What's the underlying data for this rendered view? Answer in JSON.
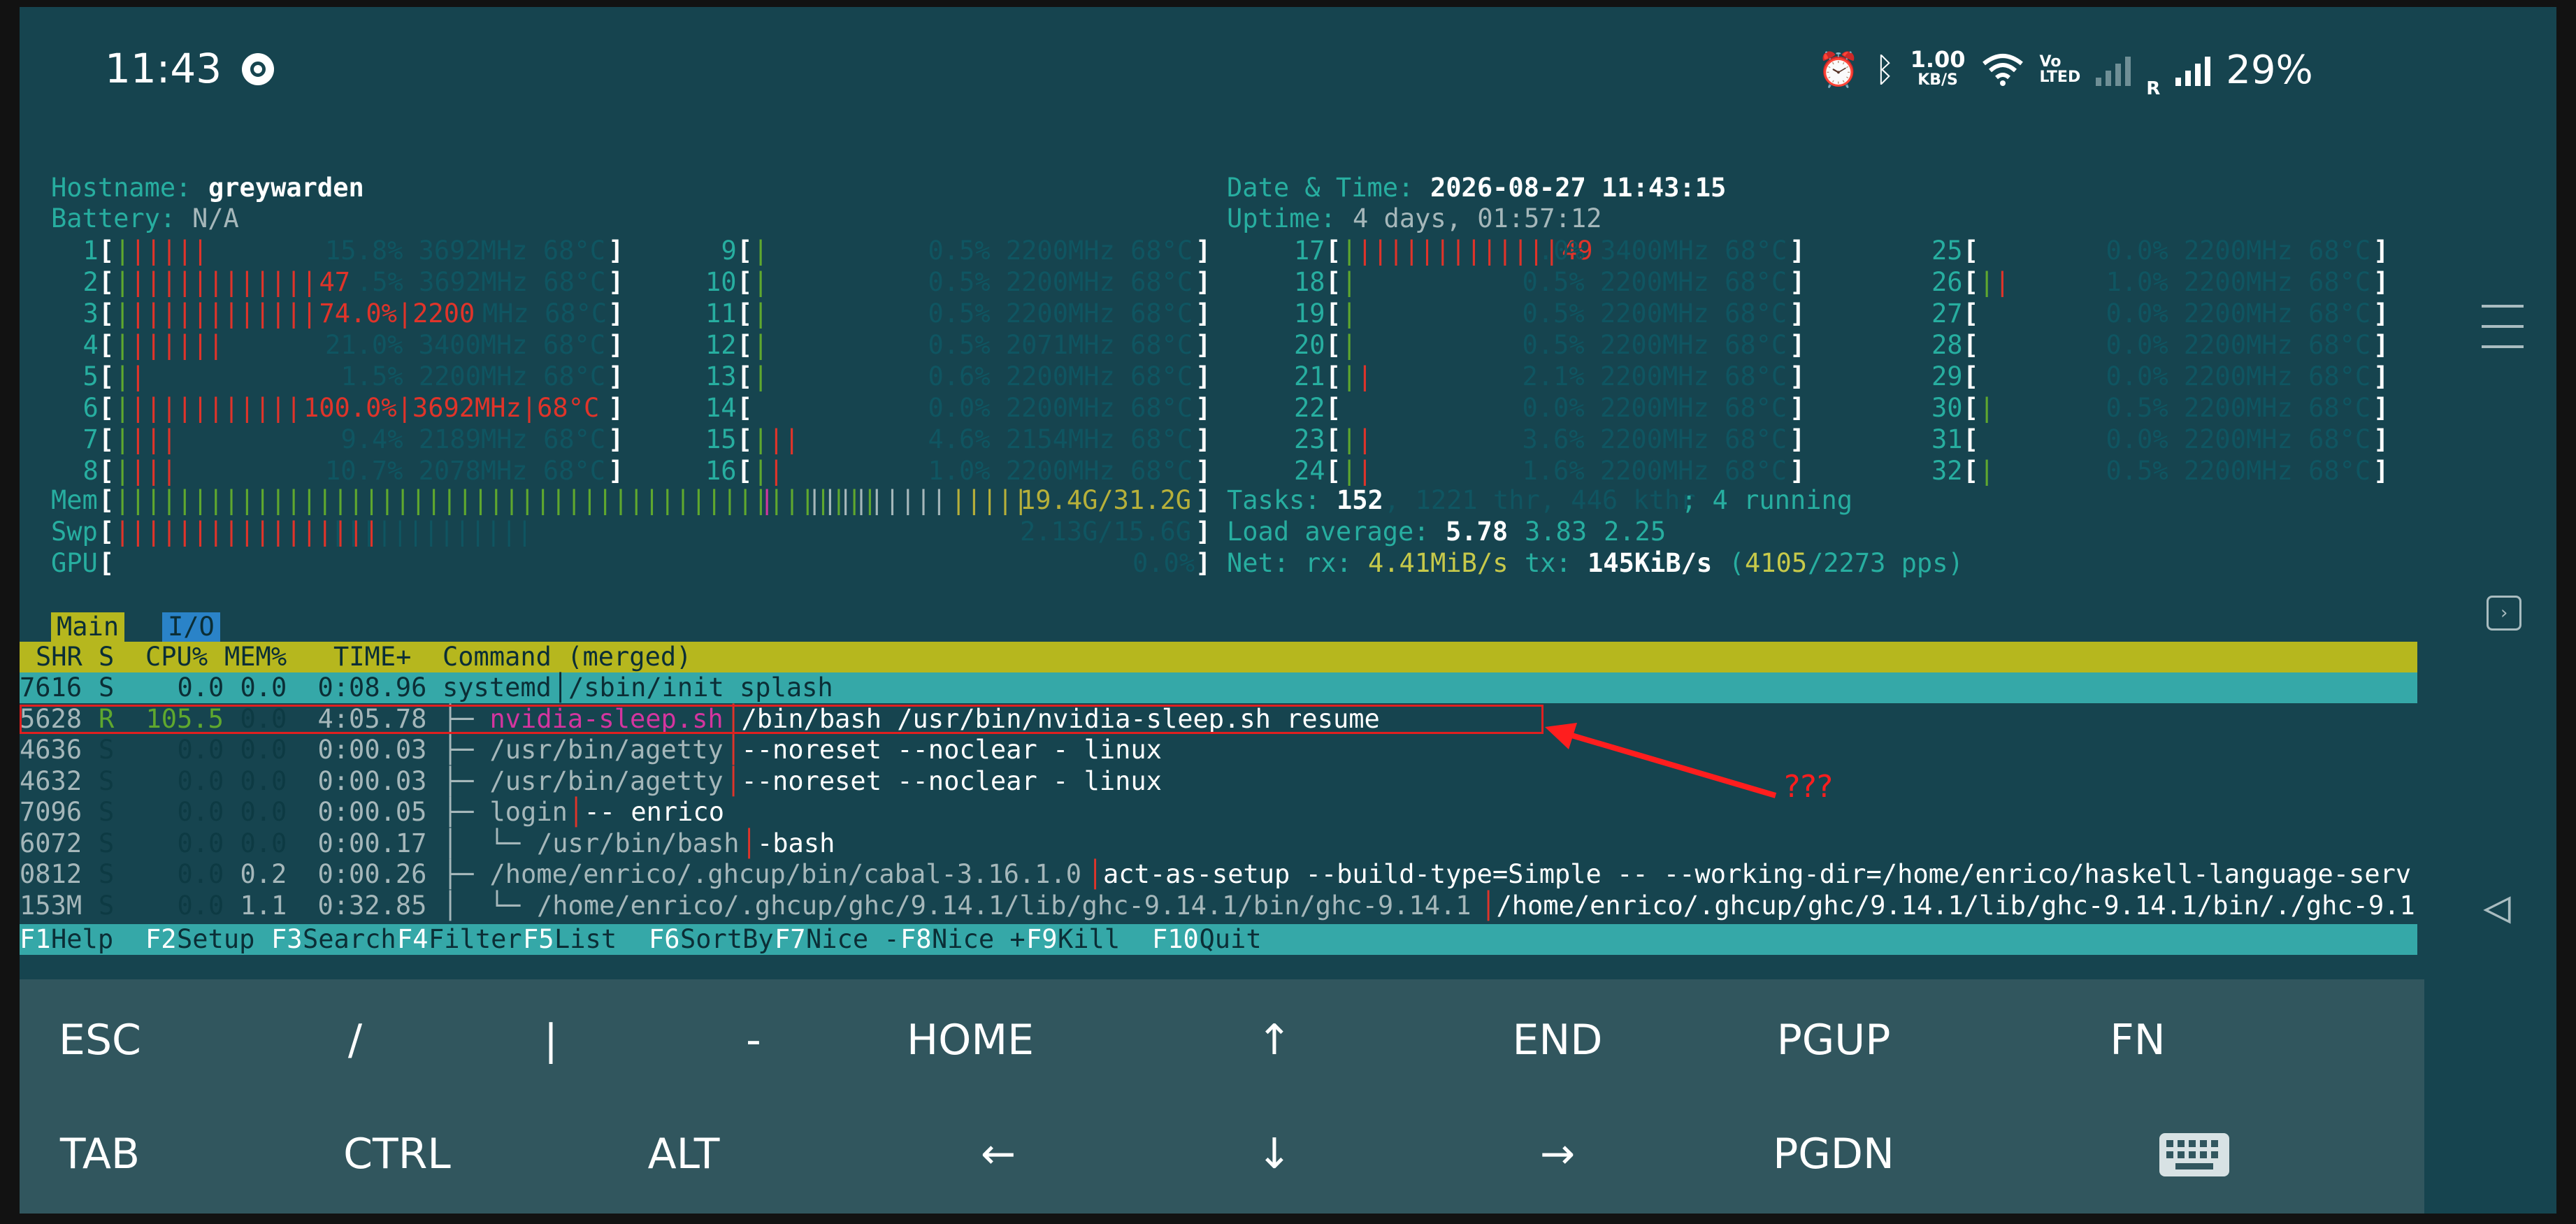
{
  "status_bar": {
    "time": "11:43",
    "net_rate_value": "1.00",
    "net_rate_unit": "KB/S",
    "volte_top": "Vo",
    "volte_bottom": "LTED",
    "roaming": "R",
    "battery": "29%",
    "icons": [
      "alarm-icon",
      "bluetooth-icon",
      "wifi-icon",
      "signal-icon"
    ]
  },
  "htop": {
    "hostname_label": "Hostname:",
    "hostname": "greywarden",
    "battery_label": "Battery:",
    "battery": "N/A",
    "datetime_label": "Date & Time:",
    "datetime": "2026-08-27 11:43:15",
    "uptime_label": "Uptime:",
    "uptime": "4 days, 01:57:12",
    "cpus": [
      {
        "id": "1",
        "bars": "||||||",
        "pre": "",
        "text": "15.8% 3692MHz 68°C"
      },
      {
        "id": "2",
        "bars": "|||||||||||||",
        "pre": "47",
        "text": ".5% 3692MHz 68°C"
      },
      {
        "id": "3",
        "bars": "|||||||||||||",
        "pre": "74.0%|2200",
        "text": "MHz 68°C"
      },
      {
        "id": "4",
        "bars": "|||||||",
        "pre": "",
        "text": "21.0% 3400MHz 68°C"
      },
      {
        "id": "5",
        "bars": "||",
        "pre": "",
        "text": "1.5% 2200MHz 68°C"
      },
      {
        "id": "6",
        "bars": "||||||||||||",
        "pre": "100.0%|3692MHz|68°C",
        "text": ""
      },
      {
        "id": "7",
        "bars": "||||",
        "pre": "",
        "text": "9.4% 2189MHz 68°C"
      },
      {
        "id": "8",
        "bars": "||||",
        "pre": "",
        "text": "10.7% 2078MHz 68°C"
      },
      {
        "id": "9",
        "bars": "|",
        "pre": "",
        "text": "0.5% 2200MHz 68°C"
      },
      {
        "id": "10",
        "bars": "|",
        "pre": "",
        "text": "0.5% 2200MHz 68°C"
      },
      {
        "id": "11",
        "bars": "|",
        "pre": "",
        "text": "0.5% 2200MHz 68°C"
      },
      {
        "id": "12",
        "bars": "|",
        "pre": "",
        "text": "0.5% 2071MHz 68°C"
      },
      {
        "id": "13",
        "bars": "|",
        "pre": "",
        "text": "0.6% 2200MHz 68°C"
      },
      {
        "id": "14",
        "bars": "",
        "pre": "",
        "text": "0.0% 2200MHz 68°C"
      },
      {
        "id": "15",
        "bars": "|||",
        "pre": "",
        "text": "4.6% 2154MHz 68°C"
      },
      {
        "id": "16",
        "bars": "||",
        "pre": "",
        "text": "1.0% 2200MHz 68°C"
      },
      {
        "id": "17",
        "bars": "||||||||||||||",
        "pre": "49",
        "text": ".0% 3400MHz 68°C"
      },
      {
        "id": "18",
        "bars": "|",
        "pre": "",
        "text": "0.5% 2200MHz 68°C"
      },
      {
        "id": "19",
        "bars": "|",
        "pre": "",
        "text": "0.5% 2200MHz 68°C"
      },
      {
        "id": "20",
        "bars": "|",
        "pre": "",
        "text": "0.5% 2200MHz 68°C"
      },
      {
        "id": "21",
        "bars": "||",
        "pre": "",
        "text": "2.1% 2200MHz 68°C"
      },
      {
        "id": "22",
        "bars": "",
        "pre": "",
        "text": "0.0% 2200MHz 68°C"
      },
      {
        "id": "23",
        "bars": "||",
        "pre": "",
        "text": "3.6% 2200MHz 68°C"
      },
      {
        "id": "24",
        "bars": "||",
        "pre": "",
        "text": "1.6% 2200MHz 68°C"
      },
      {
        "id": "25",
        "bars": "",
        "pre": "",
        "text": "0.0% 2200MHz 68°C"
      },
      {
        "id": "26",
        "bars": "||",
        "pre": "",
        "text": "1.0% 2200MHz 68°C"
      },
      {
        "id": "27",
        "bars": "",
        "pre": "",
        "text": "0.0% 2200MHz 68°C"
      },
      {
        "id": "28",
        "bars": "",
        "pre": "",
        "text": "0.0% 2200MHz 68°C"
      },
      {
        "id": "29",
        "bars": "",
        "pre": "",
        "text": "0.0% 2200MHz 68°C"
      },
      {
        "id": "30",
        "bars": "|",
        "pre": "",
        "text": "0.5% 2200MHz 68°C"
      },
      {
        "id": "31",
        "bars": "",
        "pre": "",
        "text": "0.0% 2200MHz 68°C"
      },
      {
        "id": "32",
        "bars": "|",
        "pre": "",
        "text": "0.5% 2200MHz 68°C"
      }
    ],
    "mem_label": "Mem",
    "mem_bars": "|||||||||||||||||||||||||||||||||||||||||||||||||",
    "mem_gray_bars": "|||||||||",
    "mem_tail_bars": "|||||",
    "mem_value": "19.4G/31.2G",
    "swp_label": "Swp",
    "swp_bars": "|||||||||||||||||",
    "swp_dim_bars": "|||||||||||||",
    "swp_value": "2.13G/15.6G",
    "gpu_label": "GPU",
    "gpu_value": "0.0%",
    "tasks_label": "Tasks:",
    "tasks_count": "152",
    "tasks_thr": ", 1221 thr, 446 kthr",
    "tasks_running": "; 4 running",
    "load_label": "Load average:",
    "load_1": "5.78",
    "load_5": "3.83",
    "load_15": "2.25",
    "net_label": "Net:",
    "net_rx_label": "rx:",
    "net_rx": "4.41MiB/s",
    "net_tx_label": "tx:",
    "net_tx": "145KiB/s",
    "net_pps_open": "(",
    "net_pps_rx": "4105",
    "net_pps_rest": "/2273 pps)",
    "tabs": [
      "Main",
      "I/O"
    ],
    "columns": {
      "shr": "SHR",
      "s": "S",
      "cpu": "CPU%",
      "mem": "MEM%",
      "time": "TIME+",
      "cmd": "Command (merged)"
    },
    "processes": [
      {
        "shr": "7616",
        "s": "S",
        "cpu": "0.0",
        "mem": "0.0",
        "time": "0:08.96",
        "tree": "",
        "name": "systemd",
        "args": "/sbin/init splash"
      },
      {
        "shr": "5628",
        "s": "R",
        "cpu": "105.5",
        "mem": "0.0",
        "time": "4:05.78",
        "tree": "├─ ",
        "name": "nvidia-sleep.sh",
        "args": "/bin/bash /usr/bin/nvidia-sleep.sh resume"
      },
      {
        "shr": "4636",
        "s": "S",
        "cpu": "0.0",
        "mem": "0.0",
        "time": "0:00.03",
        "tree": "├─ ",
        "name": "/usr/bin/agetty",
        "args": "--noreset --noclear - linux"
      },
      {
        "shr": "4632",
        "s": "S",
        "cpu": "0.0",
        "mem": "0.0",
        "time": "0:00.03",
        "tree": "├─ ",
        "name": "/usr/bin/agetty",
        "args": "--noreset --noclear - linux"
      },
      {
        "shr": "7096",
        "s": "S",
        "cpu": "0.0",
        "mem": "0.0",
        "time": "0:00.05",
        "tree": "├─ ",
        "name": "login",
        "args": "-- enrico"
      },
      {
        "shr": "6072",
        "s": "S",
        "cpu": "0.0",
        "mem": "0.0",
        "time": "0:00.17",
        "tree": "│  └─ ",
        "name": "/usr/bin/bash",
        "args": "-bash"
      },
      {
        "shr": "0812",
        "s": "S",
        "cpu": "0.0",
        "mem": "0.2",
        "time": "0:00.26",
        "tree": "├─ ",
        "name": "/home/enrico/.ghcup/bin/cabal-3.16.1.0",
        "args": "act-as-setup --build-type=Simple -- --working-dir=/home/enrico/haskell-language-serv"
      },
      {
        "shr": "153M",
        "s": "S",
        "cpu": "0.0",
        "mem": "1.1",
        "time": "0:32.85",
        "tree": "│  └─ ",
        "name": "/home/enrico/.ghcup/ghc/9.14.1/lib/ghc-9.14.1/bin/ghc-9.14.1",
        "args": "/home/enrico/.ghcup/ghc/9.14.1/lib/ghc-9.14.1/bin/./ghc-9.1"
      }
    ],
    "fkeys": [
      {
        "k": "F1",
        "l": "Help"
      },
      {
        "k": "F2",
        "l": "Setup"
      },
      {
        "k": "F3",
        "l": "Search"
      },
      {
        "k": "F4",
        "l": "Filter"
      },
      {
        "k": "F5",
        "l": "List"
      },
      {
        "k": "F6",
        "l": "SortBy"
      },
      {
        "k": "F7",
        "l": "Nice -"
      },
      {
        "k": "F8",
        "l": "Nice +"
      },
      {
        "k": "F9",
        "l": "Kill"
      },
      {
        "k": "F10",
        "l": "Quit"
      }
    ]
  },
  "annotation": {
    "text": "???",
    "color": "#ff1e1e"
  },
  "keyboard": {
    "row1": [
      "ESC",
      "/",
      "|",
      "-",
      "HOME",
      "↑",
      "END",
      "PGUP",
      "FN"
    ],
    "row2": [
      "TAB",
      "CTRL",
      "ALT",
      "←",
      "↓",
      "→",
      "PGDN"
    ],
    "keyboard_icon": "keyboard-icon"
  },
  "colors": {
    "terminal_bg": "#16444f",
    "header": "#b6b71e",
    "selection": "#35a8a8",
    "cpu_bar": "#e0342a",
    "accent_label": "#27aea0"
  }
}
